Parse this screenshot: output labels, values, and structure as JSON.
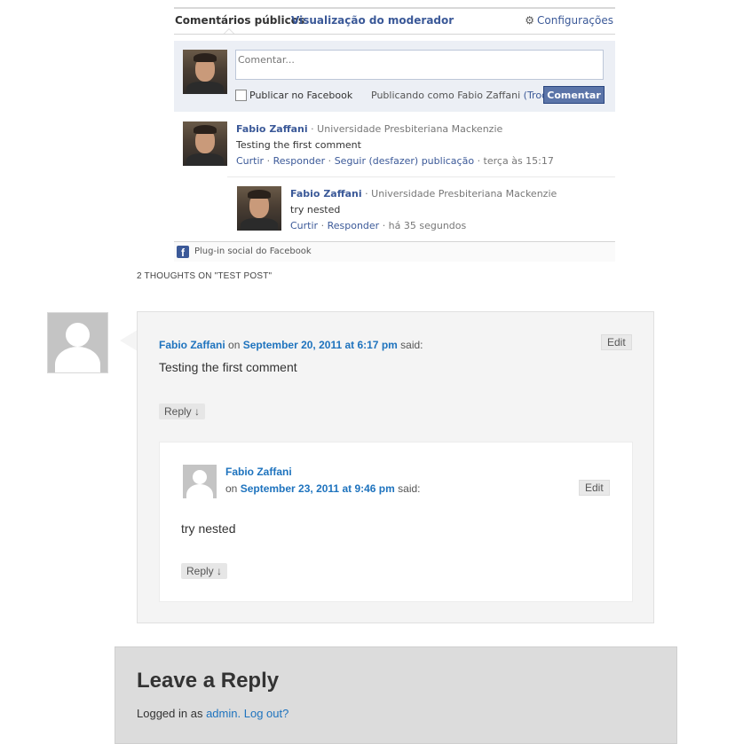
{
  "fb_plugin": {
    "tabs": {
      "active": "Comentários públicos",
      "separator": "·",
      "moderator": "Visualização do moderador"
    },
    "settings_label": "Configurações",
    "compose": {
      "placeholder": "Comentar...",
      "publish_checkbox_label": "Publicar no Facebook",
      "posting_as": "Publicando como Fabio Zaffani",
      "change_link": "(Trocar)",
      "submit_label": "Comentar"
    },
    "comments": [
      {
        "author": "Fabio Zaffani",
        "affiliation": "· Universidade Presbiteriana Mackenzie",
        "body": "Testing the first comment",
        "actions": [
          "Curtir",
          "Responder",
          "Seguir (desfazer) publicação"
        ],
        "time": "· terça às 15:17"
      },
      {
        "author": "Fabio Zaffani",
        "affiliation": "· Universidade Presbiteriana Mackenzie",
        "body": "try nested",
        "actions": [
          "Curtir",
          "Responder"
        ],
        "time": "· há 35 segundos"
      }
    ],
    "footer": "Plug-in social do Facebook"
  },
  "thoughts_heading": "2 THOUGHTS ON \"TEST POST\"",
  "wp_comments": [
    {
      "author": "Fabio Zaffani",
      "on": "on",
      "date": "September 20, 2011 at 6:17 pm",
      "said": "said:",
      "body": "Testing the first comment",
      "edit": "Edit",
      "reply": "Reply ↓"
    },
    {
      "author": "Fabio Zaffani",
      "on": "on",
      "date": "September 23, 2011 at 9:46 pm",
      "said": "said:",
      "body": "try nested",
      "edit": "Edit",
      "reply": "Reply ↓"
    }
  ],
  "leave_reply": {
    "title": "Leave a Reply",
    "logged_in_prefix": "Logged in as",
    "user_link": "admin.",
    "logout_link": "Log out?"
  }
}
